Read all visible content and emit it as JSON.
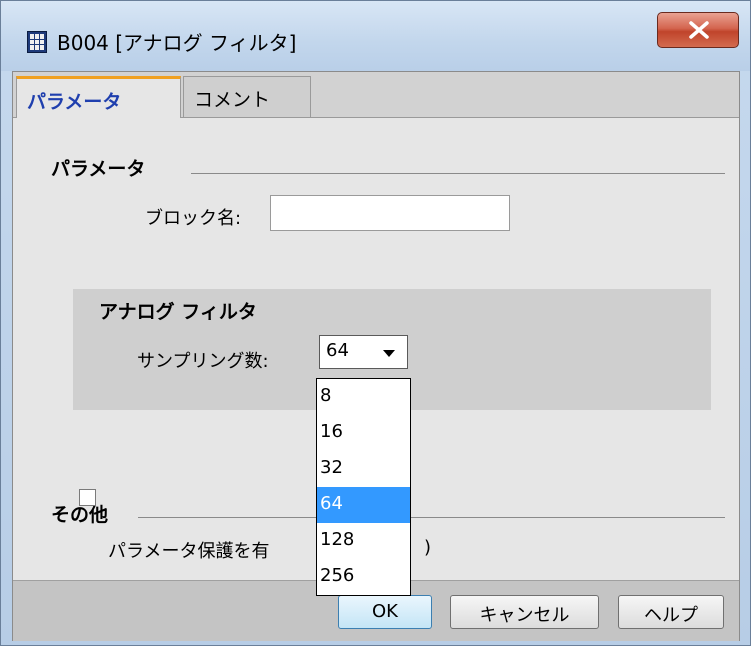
{
  "window": {
    "title": "B004 [アナログ フィルタ]",
    "app_icon": "block-icon",
    "close_icon": "close-icon"
  },
  "tabs": [
    {
      "label": "パラメータ",
      "active": true
    },
    {
      "label": "コメント",
      "active": false
    }
  ],
  "parameters": {
    "section_title": "パラメータ",
    "block_name_label": "ブロック名:",
    "block_name_value": ""
  },
  "analog_filter": {
    "section_title": "アナログ フィルタ",
    "sampling_label": "サンプリング数:",
    "sampling_value": "64",
    "options": [
      "8",
      "16",
      "32",
      "64",
      "128",
      "256"
    ],
    "selected_option": "64"
  },
  "other": {
    "section_title": "その他",
    "protect_label_visible": "パラメータ保護を有",
    "protect_label_tail": ")"
  },
  "buttons": {
    "ok": "OK",
    "cancel": "キャンセル",
    "help": "ヘルプ"
  },
  "colors": {
    "active_tab_text": "#1f3fae",
    "active_tab_accent": "#f0a020",
    "selection": "#3399ff",
    "close_button": "#c0442b"
  }
}
